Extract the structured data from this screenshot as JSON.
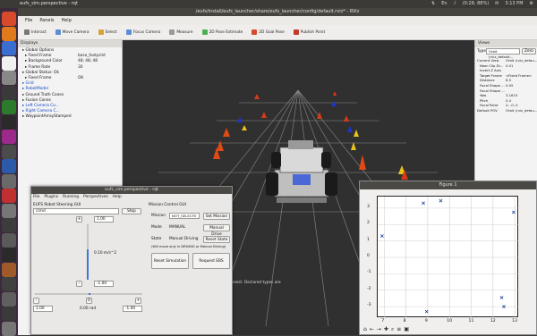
{
  "top_panel": {
    "window_title": "eufs_sim.perspective - rqt",
    "indicators": [
      "⇅",
      "En",
      "♪",
      "(0:28, 88%)",
      "✉",
      "3:13 PM",
      "⚙"
    ]
  },
  "rviz": {
    "title": "/eufs/install/eufs_launcher/share/eufs_launcher/config/default.rviz* - RViz",
    "menu": [
      "File",
      "Panels",
      "Help"
    ],
    "toolbar": [
      {
        "label": "Interact",
        "icon": "cursor-icon"
      },
      {
        "label": "Move Camera",
        "icon": "camera-move-icon"
      },
      {
        "label": "Select",
        "icon": "select-icon"
      },
      {
        "label": "Focus Camera",
        "icon": "focus-icon"
      },
      {
        "label": "Measure",
        "icon": "ruler-icon"
      },
      {
        "label": "2D Pose Estimate",
        "icon": "pose-arrow-icon"
      },
      {
        "label": "2D Goal Pose",
        "icon": "goal-arrow-icon"
      },
      {
        "label": "Publish Point",
        "icon": "pin-icon"
      }
    ],
    "displays": {
      "header": "Displays",
      "rows": [
        {
          "label": "Global Options",
          "indent": 1,
          "value": ""
        },
        {
          "label": "Fixed Frame",
          "indent": 2,
          "value": "base_footprint"
        },
        {
          "label": "Background Color",
          "indent": 2,
          "value": "48; 48; 48"
        },
        {
          "label": "Frame Rate",
          "indent": 2,
          "value": "30"
        },
        {
          "label": "Global Status: Ok",
          "indent": 1,
          "value": ""
        },
        {
          "label": "Fixed Frame",
          "indent": 2,
          "value": "OK"
        },
        {
          "label": "Grid",
          "indent": 1,
          "value": "",
          "blue": true
        },
        {
          "label": "RobotModel",
          "indent": 1,
          "value": "",
          "blue": true
        },
        {
          "label": "Ground Truth Cones",
          "indent": 1,
          "value": ""
        },
        {
          "label": "Fusion Cones",
          "indent": 1,
          "value": ""
        },
        {
          "label": "Left Camera Co...",
          "indent": 1,
          "value": "",
          "blue": true
        },
        {
          "label": "Right Camera C...",
          "indent": 1,
          "value": "",
          "blue": true
        },
        {
          "label": "WaypointArrayStamped",
          "indent": 1,
          "value": ""
        }
      ]
    },
    "views": {
      "header": "Views",
      "type_label": "Type:",
      "type_value": "Orbit (rviz_default...",
      "zero_label": "Zero",
      "rows": [
        {
          "label": "Current View",
          "value": "Orbit (rviz_defau..."
        },
        {
          "label": "Near Clip Di...",
          "value": "0.01"
        },
        {
          "label": "Invert Z Axis",
          "value": ""
        },
        {
          "label": "Target Frame",
          "value": "<Fixed Frame>"
        },
        {
          "label": "Distance",
          "value": "6.5"
        },
        {
          "label": "Focal Shape ...",
          "value": "0.05"
        },
        {
          "label": "Focal Shape ...",
          "value": ""
        },
        {
          "label": "Yaw",
          "value": "3.1615"
        },
        {
          "label": "Pitch",
          "value": "0.4"
        },
        {
          "label": "Focal Point",
          "value": "2; -0; 0"
        },
        {
          "label": "Default POV",
          "value": "Orbit (rviz_defau..."
        }
      ]
    },
    "status_text": "exist. Declared types are"
  },
  "steer": {
    "title": "eufs_sim.perspective - rqt",
    "menu": [
      "File",
      "Plugins",
      "Running",
      "Perspectives",
      "Help"
    ],
    "gui_label": "EUFS Robot Steering GUI",
    "topic_value": "/cmd",
    "stop_label": "Stop",
    "plus_label": "+",
    "minus_label": "-",
    "zero_label": "0",
    "max_speed": "1.00",
    "min_speed": "-1.00",
    "speed_text": "0.10 m/s^2",
    "left_angle": "1.00",
    "right_angle": "-1.00",
    "angle_text": "0.00 rad",
    "mission_gui_label": "Mission Control GUI",
    "mission_label": "Mission",
    "mission_value": "NOT_SELECTE",
    "set_mission_label": "Set Mission",
    "mode_label": "Mode",
    "mode_value": "MANUAL",
    "manual_drive_label": "Manual Drive",
    "state_label": "State",
    "state_value": "Manual Driving",
    "reset_state_label": "Reset State",
    "note": "(Will move only in DRIVING or Manual Driving)",
    "reset_sim_label": "Reset Simulation",
    "request_ebs_label": "Request EBS"
  },
  "figure": {
    "title": "Figure 1",
    "x_ticks": [
      "7",
      "8",
      "9",
      "10",
      "11",
      "12",
      "13"
    ],
    "y_ticks": [
      "-3",
      "-2",
      "-1",
      "0",
      "1",
      "2",
      "3"
    ],
    "toolbar_icons": [
      "home-icon",
      "back-icon",
      "forward-icon",
      "pan-icon",
      "zoom-icon",
      "settings-icon",
      "save-icon"
    ]
  },
  "chart_data": {
    "type": "scatter",
    "x": [
      6.9,
      8.8,
      8.95,
      9.6,
      12.4,
      12.5,
      12.95
    ],
    "y": [
      1.3,
      3.3,
      -3.3,
      3.45,
      -2.45,
      -3.0,
      2.75
    ],
    "xlim": [
      6.7,
      13.2
    ],
    "ylim": [
      -3.7,
      3.7
    ],
    "grid": true,
    "marker": "x"
  },
  "colors": {
    "accent": "#1446c4",
    "viewport": "#303030",
    "launcher": "#3b2a3c"
  }
}
